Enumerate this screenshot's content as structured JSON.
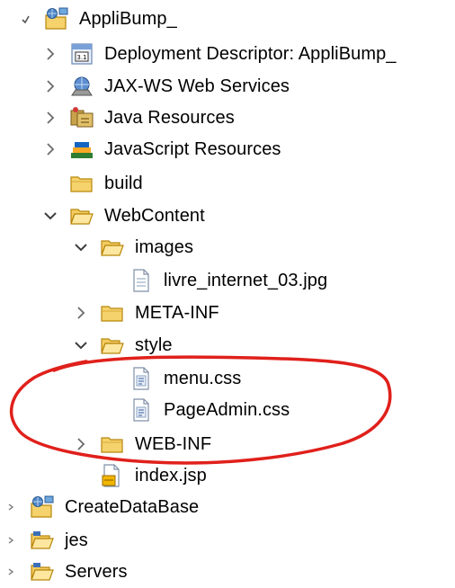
{
  "project_explorer": {
    "items": [
      {
        "label": "AppliBump_",
        "icon": "dynamic-web-project-icon",
        "toggle": "expanded-small"
      },
      {
        "label": "Deployment Descriptor: AppliBump_",
        "icon": "deployment-descriptor-icon",
        "toggle": "collapsed"
      },
      {
        "label": "JAX-WS Web Services",
        "icon": "jax-ws-icon",
        "toggle": "collapsed"
      },
      {
        "label": "Java Resources",
        "icon": "java-resources-icon",
        "toggle": "collapsed"
      },
      {
        "label": "JavaScript Resources",
        "icon": "javascript-resources-icon",
        "toggle": "collapsed"
      },
      {
        "label": "build",
        "icon": "folder-icon",
        "toggle": "none"
      },
      {
        "label": "WebContent",
        "icon": "folder-open-icon",
        "toggle": "expanded"
      },
      {
        "label": "images",
        "icon": "folder-open-icon",
        "toggle": "expanded"
      },
      {
        "label": "livre_internet_03.jpg",
        "icon": "file-icon",
        "toggle": "none"
      },
      {
        "label": "META-INF",
        "icon": "folder-icon",
        "toggle": "collapsed"
      },
      {
        "label": "style",
        "icon": "folder-open-icon",
        "toggle": "expanded"
      },
      {
        "label": "menu.css",
        "icon": "css-file-icon",
        "toggle": "none"
      },
      {
        "label": "PageAdmin.css",
        "icon": "css-file-icon",
        "toggle": "none"
      },
      {
        "label": "WEB-INF",
        "icon": "folder-icon",
        "toggle": "collapsed"
      },
      {
        "label": "index.jsp",
        "icon": "jsp-file-icon",
        "toggle": "none"
      },
      {
        "label": "CreateDataBase",
        "icon": "dynamic-web-project-icon",
        "toggle": "collapsed-small"
      },
      {
        "label": "jes",
        "icon": "project-folder-icon",
        "toggle": "collapsed-small"
      },
      {
        "label": "Servers",
        "icon": "project-folder-icon",
        "toggle": "collapsed-small"
      }
    ]
  },
  "annotation": {
    "color": "#e0201b"
  }
}
